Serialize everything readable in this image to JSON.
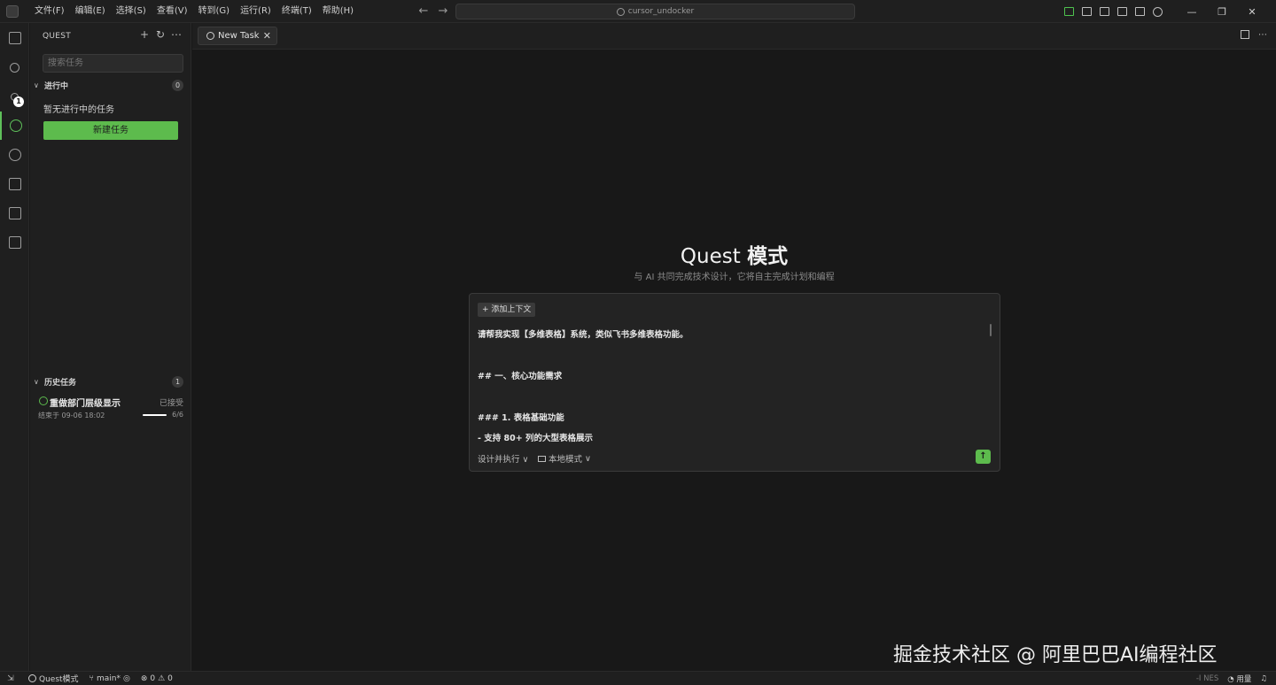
{
  "menu": [
    "文件(F)",
    "编辑(E)",
    "选择(S)",
    "查看(V)",
    "转到(G)",
    "运行(R)",
    "终端(T)",
    "帮助(H)"
  ],
  "command_center": "cursor_undocker",
  "window_controls": {
    "minimize": "—",
    "restore": "❐",
    "close": "✕"
  },
  "activity": {
    "scm_badge": "1"
  },
  "sidebar": {
    "title": "QUEST",
    "search_placeholder": "搜索任务",
    "in_progress": {
      "label": "进行中",
      "count": "0",
      "empty_text": "暂无进行中的任务",
      "new_button": "新建任务"
    },
    "history": {
      "label": "历史任务",
      "count": "1",
      "items": [
        {
          "name": "重做部门层级显示",
          "status": "已接受",
          "time": "结束于 09-06 18:02",
          "progress": "6/6",
          "progress_fraction": 1.0
        }
      ]
    }
  },
  "tab": {
    "label": "New Task",
    "close": "✕"
  },
  "hero": {
    "title_en": "Quest",
    "title_zh": "模式",
    "subtitle": "与 AI 共同完成技术设计，它将自主完成计划和编程"
  },
  "composer": {
    "add_context": "+ 添加上下文",
    "lines": [
      "请帮我实现【多维表格】系统，类似飞书多维表格功能。",
      "## 一、核心功能需求",
      "### 1. 表格基础功能",
      "- 支持 80+ 列的大型表格展示"
    ],
    "mode": "设计并执行",
    "env": "本地模式",
    "send": "↑"
  },
  "watermark": "掘金技术社区 @ 阿里巴巴AI编程社区",
  "status": {
    "quest": "Quest模式",
    "branch": "main*",
    "errors": "0",
    "warnings": "0",
    "nes": "-I NES",
    "usage": "用量"
  },
  "colors": {
    "accent": "#5dbb4d",
    "background": "#181818",
    "panel": "#1f1f1f"
  }
}
